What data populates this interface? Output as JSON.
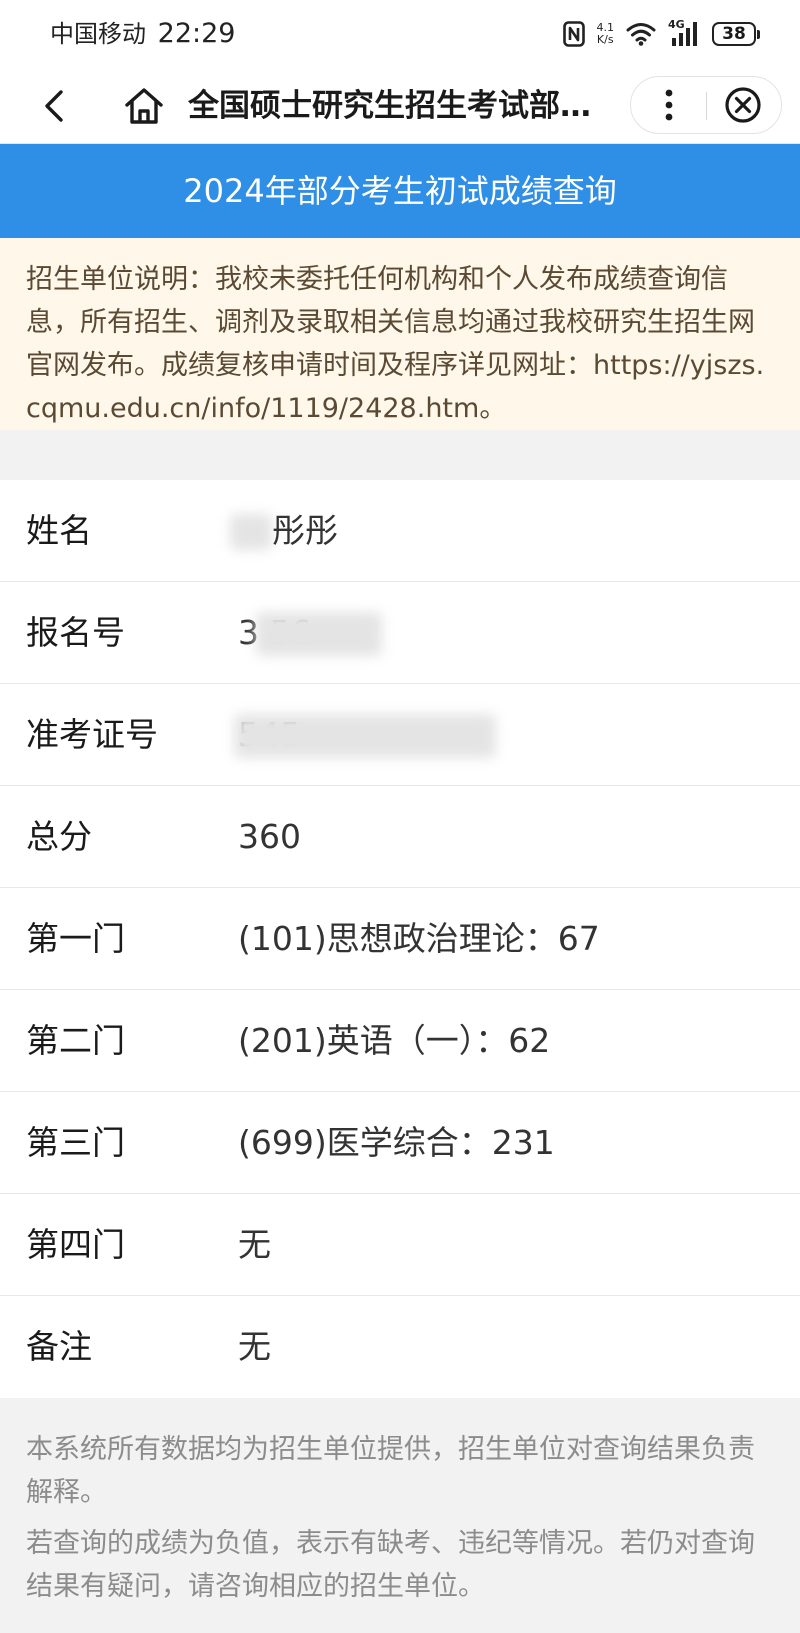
{
  "status_bar": {
    "carrier": "中国移动",
    "time": "22:29",
    "net_speed_value": "4.1",
    "net_speed_unit": "K/s",
    "signal_label": "4G",
    "battery": "38"
  },
  "nav": {
    "title": "全国硕士研究生招生考试部分考生初试成绩查询"
  },
  "header": {
    "title": "2024年部分考生初试成绩查询"
  },
  "notice": {
    "text": "招生单位说明：我校未委托任何机构和个人发布成绩查询信息，所有招生、调剂及录取相关信息均通过我校研究生招生网官网发布。成绩复核申请时间及程序详见网址：https://yjszs.cqmu.edu.cn/info/1119/2428.htm。"
  },
  "result": {
    "rows": [
      {
        "label": "姓名",
        "value": "彤彤"
      },
      {
        "label": "报名号",
        "value": "3      56"
      },
      {
        "label": "准考证号",
        "value": "                545"
      },
      {
        "label": "总分",
        "value": "360"
      },
      {
        "label": "第一门",
        "value": "(101)思想政治理论：67"
      },
      {
        "label": "第二门",
        "value": "(201)英语（一）：62"
      },
      {
        "label": "第三门",
        "value": "(699)医学综合：231"
      },
      {
        "label": "第四门",
        "value": "无"
      },
      {
        "label": "备注",
        "value": "无"
      }
    ]
  },
  "footer": {
    "line1": "本系统所有数据均为招生单位提供，招生单位对查询结果负责解释。",
    "line2": "若查询的成绩为负值，表示有缺考、违纪等情况。若仍对查询结果有疑问，请咨询相应的招生单位。"
  },
  "colors": {
    "header_bg": "#2f8ee5",
    "notice_bg": "#fff7e9",
    "page_bg": "#f2f2f2"
  }
}
